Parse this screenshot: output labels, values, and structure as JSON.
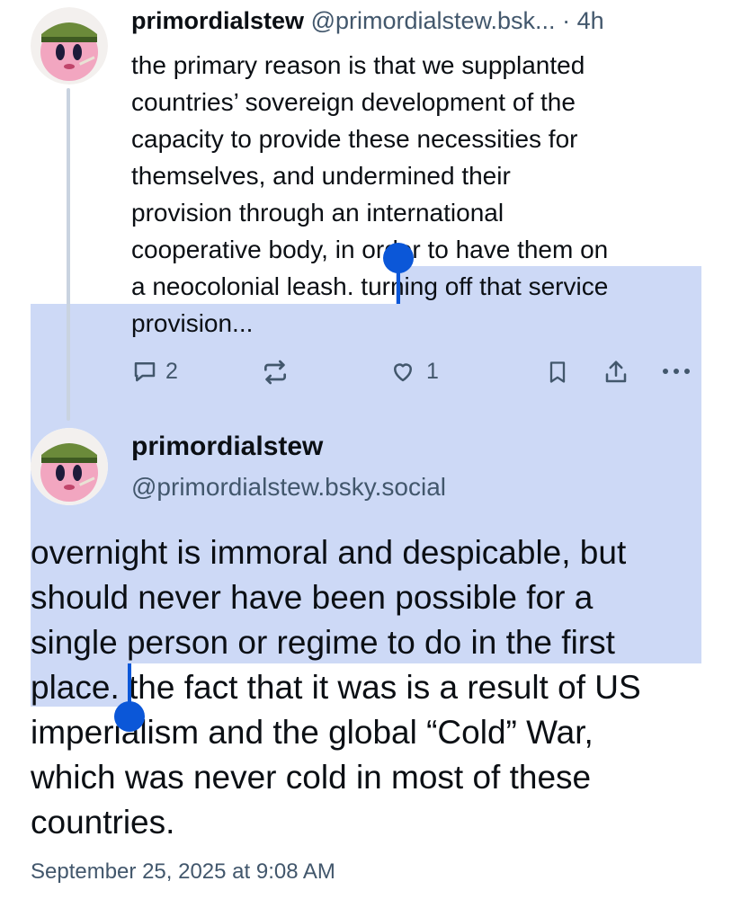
{
  "post1": {
    "display_name": "primordialstew",
    "handle": "@primordialstew.bsk...",
    "separator": "·",
    "time": "4h",
    "lines": [
      "the primary reason is that we supplanted",
      "countries’ sovereign development of the",
      "capacity to provide these necessities for",
      "themselves, and undermined their",
      "provision through an international",
      "cooperative body, in order to have them on",
      "a neocolonial leash. ",
      "provision..."
    ],
    "selected_tail": "turning off that service",
    "actions": {
      "reply_count": "2",
      "like_count": "1"
    }
  },
  "post2": {
    "display_name": "primordialstew",
    "handle": "@primordialstew.bsky.social",
    "lines": [
      "overnight is immoral and despicable, but",
      "should never have been possible for a",
      "single person or regime to do in the first",
      "place.",
      "imperialism and the global “Cold” War,",
      "which was never cold in most of these",
      "countries."
    ],
    "line4_tail": " the fact that it was is a result of US",
    "timestamp": "September 25, 2025 at 9:08 AM"
  },
  "colors": {
    "selection": "#cdd9f6",
    "selection_handle": "#0b57d8",
    "muted_text": "#42576c",
    "thread_line": "#c9d3e0"
  },
  "icons": [
    "reply-icon",
    "repost-icon",
    "like-icon",
    "bookmark-icon",
    "share-icon",
    "more-icon"
  ]
}
